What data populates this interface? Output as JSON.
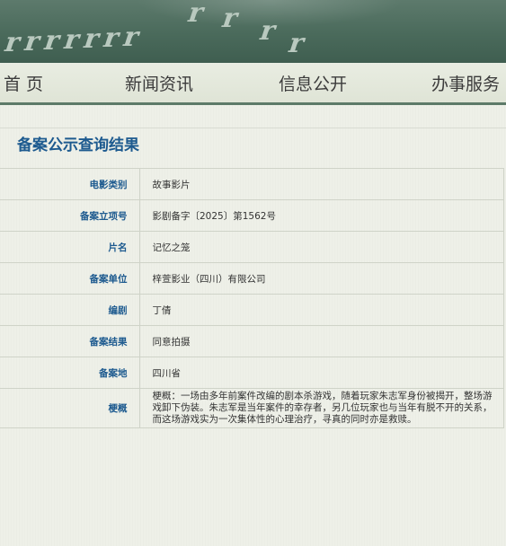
{
  "header": {
    "banner_glyphs": [
      "r",
      "r",
      "r",
      "r",
      "r",
      "r",
      "r",
      "r",
      "r",
      "r",
      "r"
    ]
  },
  "nav": {
    "items": [
      {
        "label": "首 页"
      },
      {
        "label": "新闻资讯"
      },
      {
        "label": "信息公开"
      },
      {
        "label": "办事服务"
      }
    ]
  },
  "main": {
    "title": "备案公示查询结果",
    "rows": [
      {
        "key": "电影类别",
        "value": "故事影片"
      },
      {
        "key": "备案立项号",
        "value": "影剧备字〔2025〕第1562号"
      },
      {
        "key": "片名",
        "value": "记忆之笼"
      },
      {
        "key": "备案单位",
        "value": "梓萱影业（四川）有限公司"
      },
      {
        "key": "编剧",
        "value": "丁倩"
      },
      {
        "key": "备案结果",
        "value": "同意拍摄"
      },
      {
        "key": "备案地",
        "value": "四川省"
      },
      {
        "key": "梗概",
        "value": "梗概：一场由多年前案件改编的剧本杀游戏，随着玩家朱志军身份被揭开，整场游戏卸下伪装。朱志军是当年案件的幸存者，另几位玩家也与当年有脱不开的关系，而这场游戏实为一次集体性的心理治疗，寻真的同时亦是救赎。"
      }
    ]
  },
  "colors": {
    "accent": "#1d5a8f",
    "banner": "#4a6a5b",
    "nav_bg": "#e3e7da",
    "page_bg": "#eef0e8"
  }
}
